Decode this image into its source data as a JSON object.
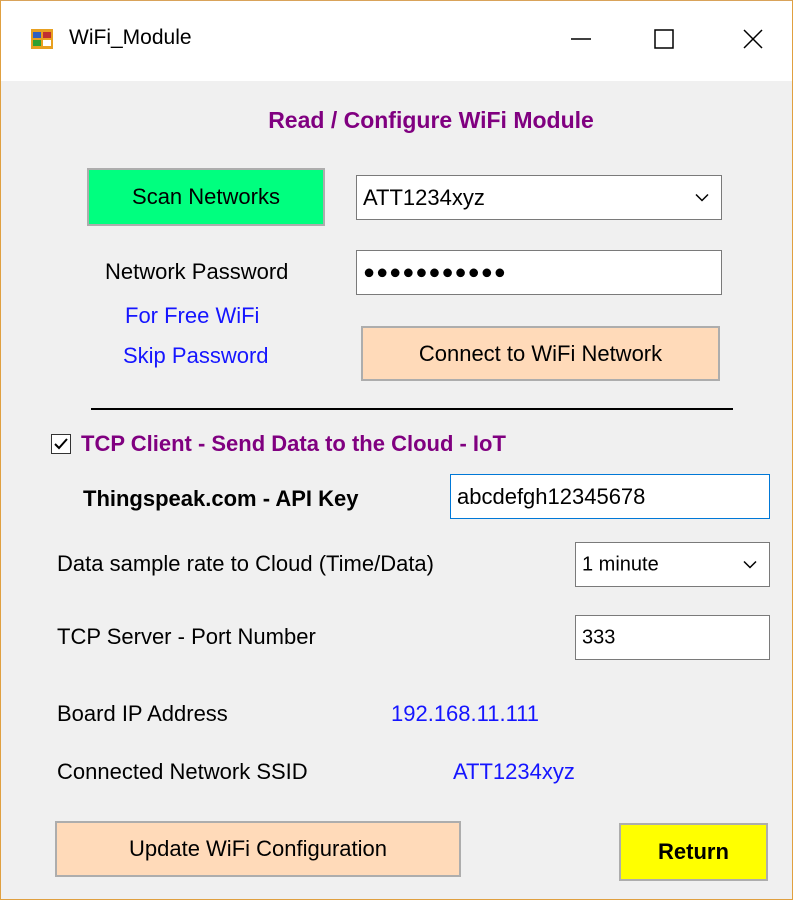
{
  "window": {
    "title": "WiFi_Module",
    "controls": [
      "minimize-icon",
      "maximize-icon",
      "close-icon"
    ]
  },
  "heading": "Read / Configure WiFi Module",
  "scan": {
    "button_label": "Scan Networks",
    "network_select_value": "ATT1234xyz"
  },
  "password": {
    "label": "Network Password",
    "value": "●●●●●●●●●●●",
    "hint_line1": "For Free WiFi",
    "hint_line2": "Skip Password"
  },
  "connect_button_label": "Connect to WiFi Network",
  "tcp": {
    "checkbox_label": "TCP Client - Send Data to the Cloud - IoT",
    "checked": true,
    "api_key_label": "Thingspeak.com - API Key",
    "api_key_value": "abcdefgh12345678",
    "sample_rate_label": "Data sample rate to Cloud (Time/Data)",
    "sample_rate_value": "1 minute",
    "port_label": "TCP Server - Port Number",
    "port_value": "333"
  },
  "info": {
    "ip_label": "Board IP Address",
    "ip_value": "192.168.11.111",
    "ssid_label": "Connected Network SSID",
    "ssid_value": "ATT1234xyz"
  },
  "footer": {
    "update_button_label": "Update WiFi Configuration",
    "return_button_label": "Return"
  },
  "colors": {
    "scan_button": "#00ff7f",
    "peach_button": "#ffdab9",
    "return_button": "#ffff00",
    "heading": "#800080",
    "info_value": "#1515ff",
    "window_border": "#e0a040"
  }
}
